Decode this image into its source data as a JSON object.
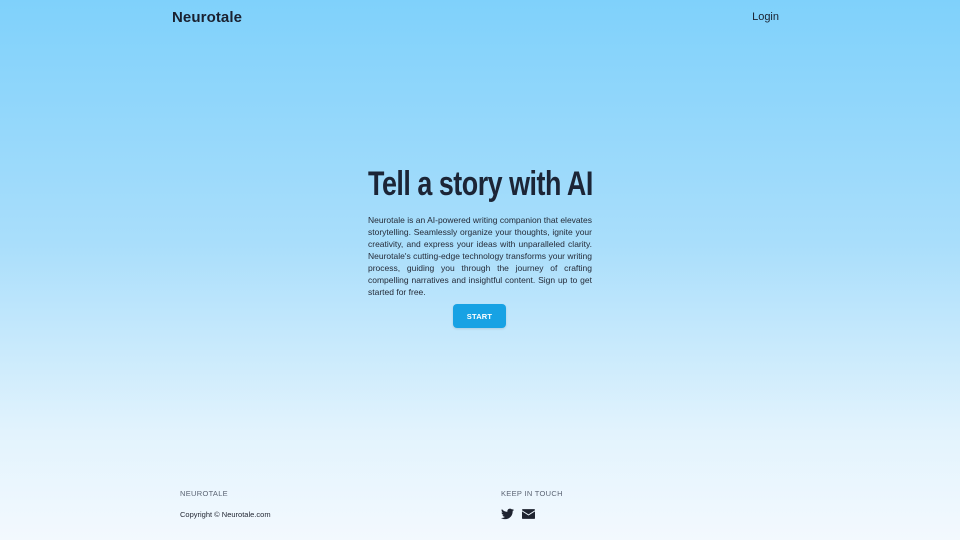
{
  "header": {
    "brand": "Neurotale",
    "login_label": "Login"
  },
  "hero": {
    "title": "Tell a story with AI",
    "description": "Neurotale is an AI-powered writing companion that elevates storytelling. Seamlessly organize your thoughts, ignite your creativity, and express your ideas with unparalleled clarity. Neurotale's cutting-edge technology transforms your writing process, guiding you through the journey of crafting compelling narratives and insightful content. Sign up to get started for free.",
    "start_label": "START"
  },
  "footer": {
    "brand_heading": "NEUROTALE",
    "copyright": "Copyright © Neurotale.com",
    "contact_heading": "KEEP IN TOUCH",
    "social_icons": [
      "twitter-icon",
      "envelope-icon"
    ]
  },
  "colors": {
    "accent": "#17a2e4",
    "text_dark": "#1c2536",
    "bg_top": "#7fd1fb",
    "bg_bottom": "#f3f9fe"
  }
}
